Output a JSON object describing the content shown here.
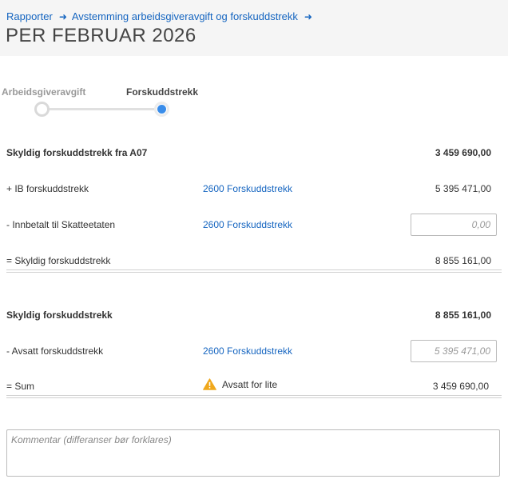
{
  "breadcrumb": {
    "items": [
      "Rapporter",
      "Avstemming arbeidsgiveravgift og forskuddstrekk"
    ]
  },
  "page_title": "PER FEBRUAR 2026",
  "stepper": {
    "steps": [
      {
        "label": "Arbeidsgiveravgift",
        "state": "inactive"
      },
      {
        "label": "Forskuddstrekk",
        "state": "active"
      }
    ]
  },
  "section1": {
    "header_label": "Skyldig forskuddstrekk fra A07",
    "header_amount": "3 459 690,00",
    "ib_label": "+ IB forskuddstrekk",
    "ib_account": "2600 Forskuddstrekk",
    "ib_amount": "5 395 471,00",
    "paid_label": "- Innbetalt til Skatteetaten",
    "paid_account": "2600 Forskuddstrekk",
    "paid_placeholder": "0,00",
    "owed_label": "= Skyldig forskuddstrekk",
    "owed_amount": "8 855 161,00"
  },
  "section2": {
    "header_label": "Skyldig forskuddstrekk",
    "header_amount": "8 855 161,00",
    "reserved_label": "- Avsatt forskuddstrekk",
    "reserved_account": "2600 Forskuddstrekk",
    "reserved_placeholder": "5 395 471,00",
    "sum_label": "= Sum",
    "warning_text": "Avsatt for lite",
    "sum_amount": "3 459 690,00"
  },
  "comment": {
    "placeholder": "Kommentar (differanser bør forklares)"
  },
  "colors": {
    "link": "#1565c0",
    "active_step": "#3a8dea",
    "warning": "#f0a81c",
    "header_bg": "#f5f5f5"
  }
}
